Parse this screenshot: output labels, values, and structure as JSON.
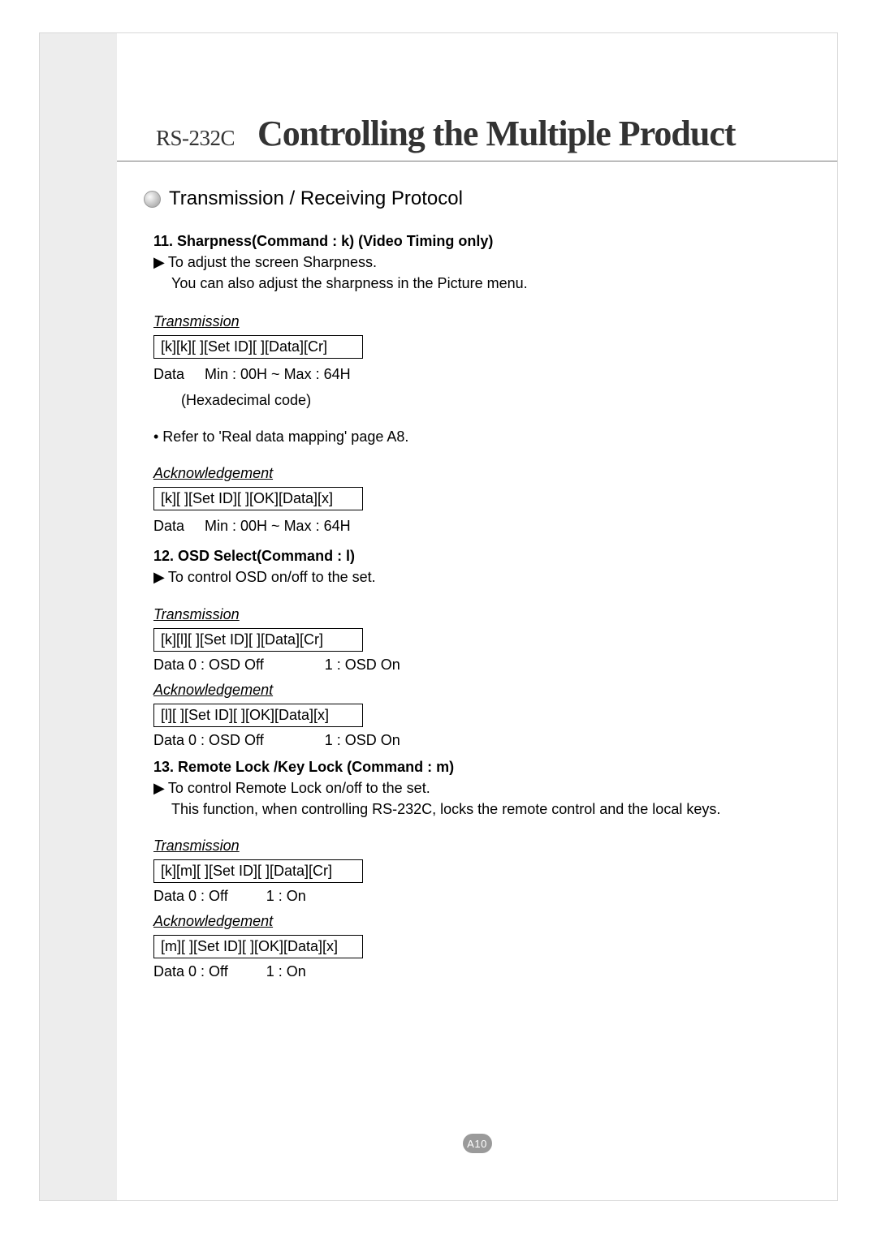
{
  "header": {
    "prefix": "RS-232C",
    "title": "Controlling the Multiple Product"
  },
  "section_heading": "Transmission / Receiving Protocol",
  "cmd11": {
    "heading": "11. Sharpness(Command : k) (Video Timing only)",
    "desc1": "To adjust the screen Sharpness.",
    "desc2": "You can also adjust the sharpness in the Picture menu.",
    "trans_label": "Transmission",
    "trans_box": "[k][k][ ][Set ID][ ][Data][Cr]",
    "data1": "Data     Min : 00H ~ Max : 64H",
    "data2": "(Hexadecimal code)",
    "note": "• Refer to 'Real data mapping' page A8.",
    "ack_label": "Acknowledgement",
    "ack_box": "[k][ ][Set ID][ ][OK][Data][x]",
    "ack_data": "Data     Min : 00H ~ Max : 64H"
  },
  "cmd12": {
    "heading": "12. OSD Select(Command : l)",
    "desc1": "To control OSD on/off to the set.",
    "trans_label": "Transmission",
    "trans_box": "[k][l][ ][Set ID][ ][Data][Cr]",
    "trans_data_a": "Data 0 : OSD Off",
    "trans_data_b": "1 : OSD On",
    "ack_label": "Acknowledgement",
    "ack_box": "[l][ ][Set ID][ ][OK][Data][x]",
    "ack_data_a": "Data 0 : OSD Off",
    "ack_data_b": "1 : OSD On"
  },
  "cmd13": {
    "heading": "13. Remote Lock /Key Lock (Command : m)",
    "desc1": "To control Remote Lock on/off to the set.",
    "desc2": "This function, when controlling RS-232C, locks the remote control and the local keys.",
    "trans_label": "Transmission",
    "trans_box": "[k][m][ ][Set ID][ ][Data][Cr]",
    "trans_data_a": "Data 0 : Off",
    "trans_data_b": "1 : On",
    "ack_label": "Acknowledgement",
    "ack_box": "[m][ ][Set ID][ ][OK][Data][x]",
    "ack_data_a": "Data 0 : Off",
    "ack_data_b": "1 : On"
  },
  "page_number": "A10"
}
